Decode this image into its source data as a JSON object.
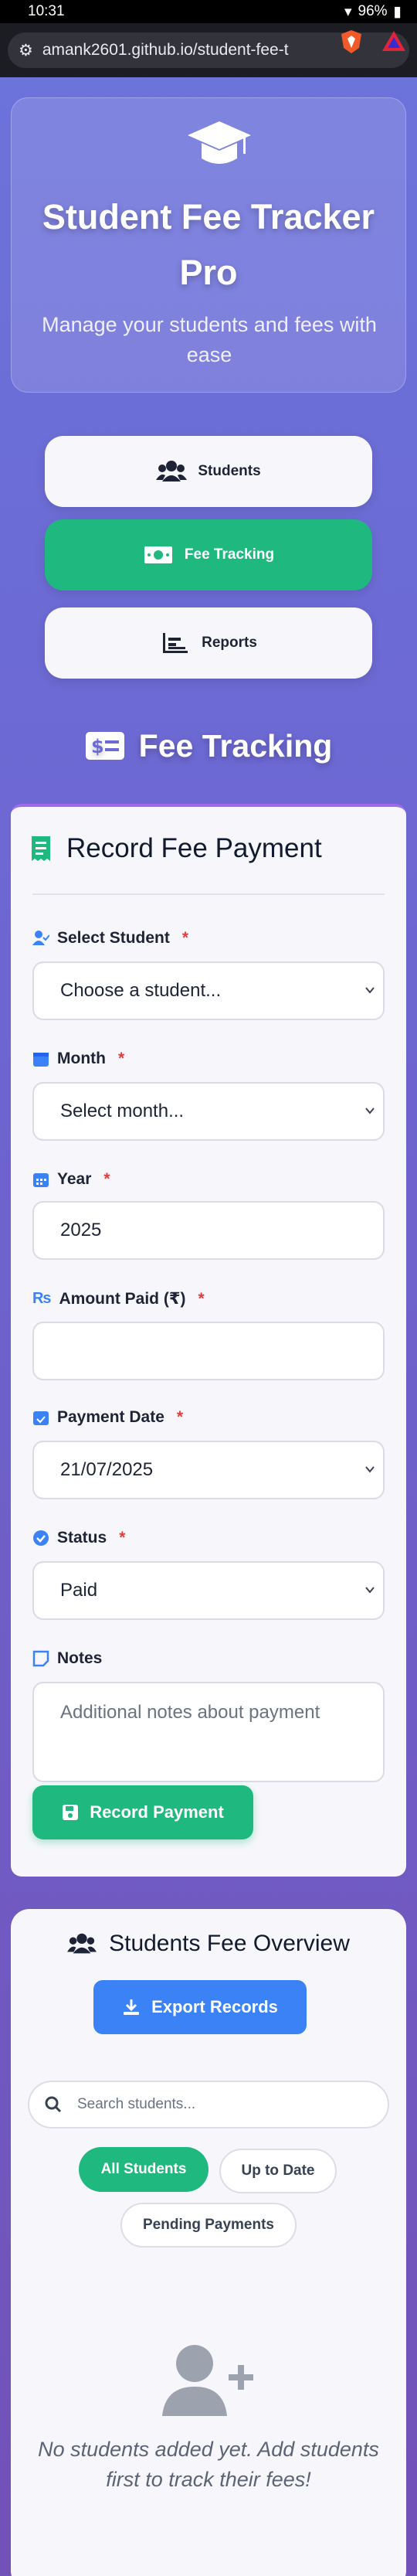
{
  "status_bar": {
    "time": "10:31",
    "battery": "96%"
  },
  "browser": {
    "url": "amank2601.github.io/student-fee-t"
  },
  "header": {
    "title": "Student Fee Tracker Pro",
    "subtitle": "Manage your students and fees with ease",
    "icon": "graduation-cap-icon"
  },
  "nav": {
    "students": "Students",
    "fee_tracking": "Fee Tracking",
    "reports": "Reports",
    "active": "fee_tracking"
  },
  "section_title": "Fee Tracking",
  "form": {
    "title": "Record Fee Payment",
    "student_label": "Select Student",
    "student_value": "Choose a student...",
    "month_label": "Month",
    "month_value": "Select month...",
    "year_label": "Year",
    "year_value": "2025",
    "amount_label": "Amount Paid (₹)",
    "amount_value": "",
    "date_label": "Payment Date",
    "date_value": "21/07/2025",
    "status_label": "Status",
    "status_value": "Paid",
    "notes_label": "Notes",
    "notes_placeholder": "Additional notes about payment",
    "required_mark": "*",
    "submit_label": "Record Payment"
  },
  "overview": {
    "title": "Students Fee Overview",
    "export_label": "Export Records",
    "search_placeholder": "Search students...",
    "filters": [
      "All Students",
      "Up to Date",
      "Pending Payments"
    ],
    "active_filter": "All Students",
    "empty_message": "No students added yet. Add students first to track their fees!"
  },
  "colors": {
    "accent_green": "#1fb97f",
    "accent_blue": "#3b82f6",
    "required_red": "#e23d3d"
  }
}
